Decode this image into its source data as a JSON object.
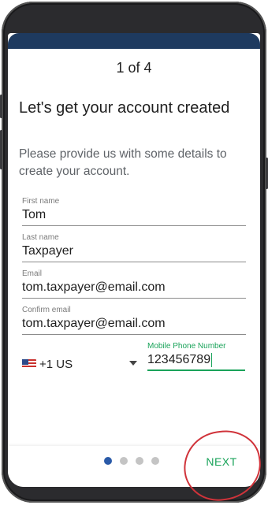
{
  "header": {
    "step_indicator": "1 of 4"
  },
  "content": {
    "title": "Let's get your account created",
    "subtitle": "Please provide us with some details to create your account."
  },
  "form": {
    "first_name": {
      "label": "First name",
      "value": "Tom"
    },
    "last_name": {
      "label": "Last name",
      "value": "Taxpayer"
    },
    "email": {
      "label": "Email",
      "value": "tom.taxpayer@email.com"
    },
    "confirm_email": {
      "label": "Confirm email",
      "value": "tom.taxpayer@email.com"
    },
    "country_code": {
      "value": "+1 US",
      "flag_icon": "us-flag-icon"
    },
    "mobile_phone": {
      "label": "Mobile Phone Number",
      "value": "123456789"
    }
  },
  "footer": {
    "page_count": 4,
    "active_page": 1,
    "next_label": "NEXT"
  },
  "colors": {
    "accent_green": "#1aa35a",
    "active_dot": "#2a5aa8",
    "header_bar": "#1e3a5f",
    "annotation_red": "#d0333a"
  }
}
